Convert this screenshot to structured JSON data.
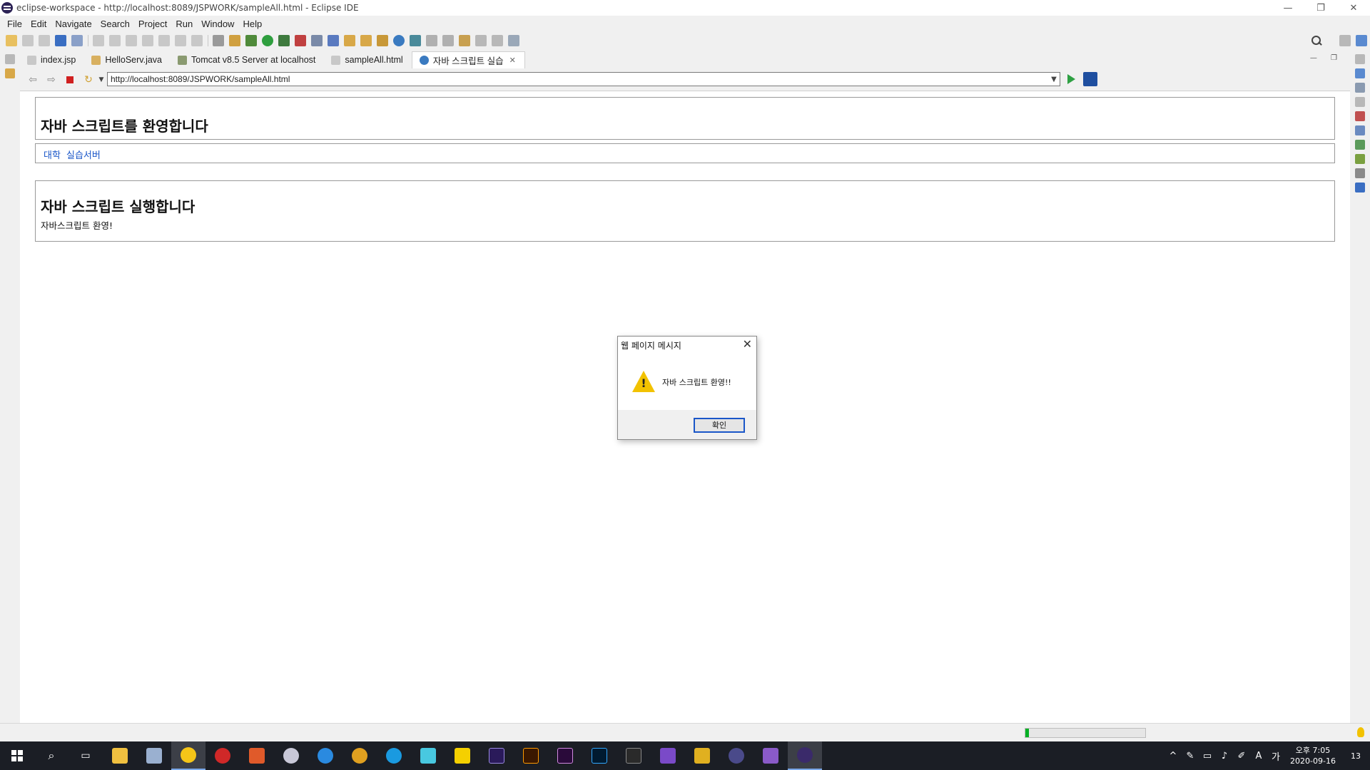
{
  "window": {
    "title": "eclipse-workspace - http://localhost:8089/JSPWORK/sampleAll.html - Eclipse IDE",
    "minimize": "—",
    "restore": "❐",
    "close": "✕"
  },
  "menu": [
    "File",
    "Edit",
    "Navigate",
    "Search",
    "Project",
    "Run",
    "Window",
    "Help"
  ],
  "tabs": [
    {
      "label": "index.jsp",
      "icon": "jsp-file-icon"
    },
    {
      "label": "HelloServ.java",
      "icon": "java-file-icon"
    },
    {
      "label": "Tomcat v8.5 Server at localhost",
      "icon": "server-icon"
    },
    {
      "label": "sampleAll.html",
      "icon": "html-file-icon"
    },
    {
      "label": "자바 스크립트 실습",
      "icon": "browser-globe-icon",
      "active": true,
      "close": "✕"
    }
  ],
  "browser": {
    "url": "http://localhost:8089/JSPWORK/sampleAll.html"
  },
  "page": {
    "heading": "자바 스크립트를 환영합니다",
    "nav_links": [
      "대학",
      "실습서버"
    ],
    "section_heading": "자바 스크립트 실행합니다",
    "section_text": "자바스크립트 환영!"
  },
  "dialog": {
    "title": "웹 페이지 메시지",
    "close": "✕",
    "message": "자바 스크립트 환영!!",
    "ok_label": "확인"
  },
  "status": {
    "progress": 0.03
  },
  "taskbar": {
    "time": "오후 7:05",
    "date": "2020-09-16",
    "notification_count": "13",
    "ime": "A",
    "ime2": "가"
  },
  "colors": {
    "link": "#1a56c8",
    "progress": "#06b025",
    "taskbar": "#1b1e25"
  }
}
